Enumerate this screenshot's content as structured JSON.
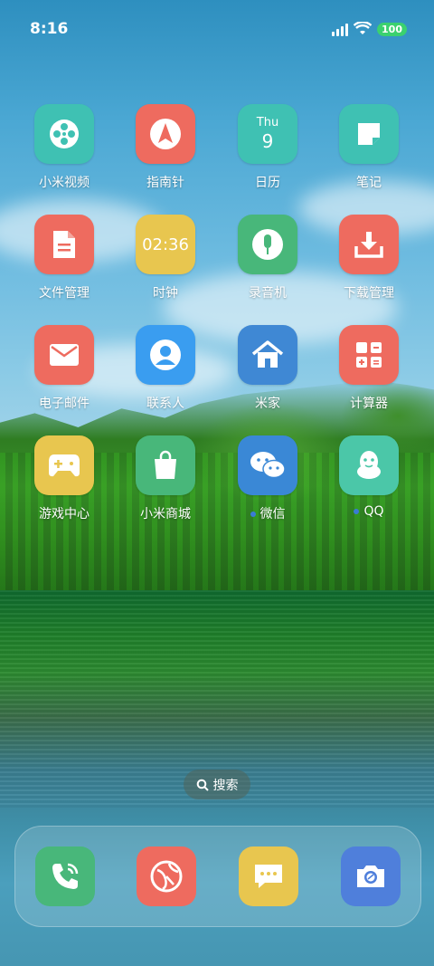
{
  "status_bar": {
    "time": "8:16",
    "battery": "100"
  },
  "apps": [
    {
      "name": "小米视频",
      "icon": "film-reel-icon",
      "color": "#3fc1b3"
    },
    {
      "name": "指南针",
      "icon": "compass-icon",
      "color": "#ee6b5f"
    },
    {
      "name": "日历",
      "icon": "calendar-icon",
      "color": "#3fc1b3",
      "day": "Thu",
      "date": "9"
    },
    {
      "name": "笔记",
      "icon": "note-icon",
      "color": "#3fc1b3"
    },
    {
      "name": "文件管理",
      "icon": "file-icon",
      "color": "#ee6b5f"
    },
    {
      "name": "时钟",
      "icon": "clock-icon",
      "color": "#e8c64f",
      "clock_text": "02:36"
    },
    {
      "name": "录音机",
      "icon": "microphone-icon",
      "color": "#48b77a"
    },
    {
      "name": "下载管理",
      "icon": "download-icon",
      "color": "#ee6b5f"
    },
    {
      "name": "电子邮件",
      "icon": "mail-icon",
      "color": "#ee6b5f"
    },
    {
      "name": "联系人",
      "icon": "contact-icon",
      "color": "#3a9df0"
    },
    {
      "name": "米家",
      "icon": "home-icon",
      "color": "#3f88d4"
    },
    {
      "name": "计算器",
      "icon": "calculator-icon",
      "color": "#ee6b5f"
    },
    {
      "name": "游戏中心",
      "icon": "gamepad-icon",
      "color": "#e8c64f"
    },
    {
      "name": "小米商城",
      "icon": "shopping-bag-icon",
      "color": "#48b77a"
    },
    {
      "name": "微信",
      "icon": "wechat-icon",
      "color": "#3a88d6",
      "notification_dot": true
    },
    {
      "name": "QQ",
      "icon": "qq-penguin-icon",
      "color": "#4bc7a8",
      "notification_dot": true
    }
  ],
  "search": {
    "label": "搜索"
  },
  "dock": [
    {
      "icon": "phone-icon",
      "color": "#48b77a"
    },
    {
      "icon": "browser-icon",
      "color": "#ee6b5f"
    },
    {
      "icon": "message-icon",
      "color": "#e8c64f"
    },
    {
      "icon": "camera-icon",
      "color": "#4f7fdb"
    }
  ]
}
